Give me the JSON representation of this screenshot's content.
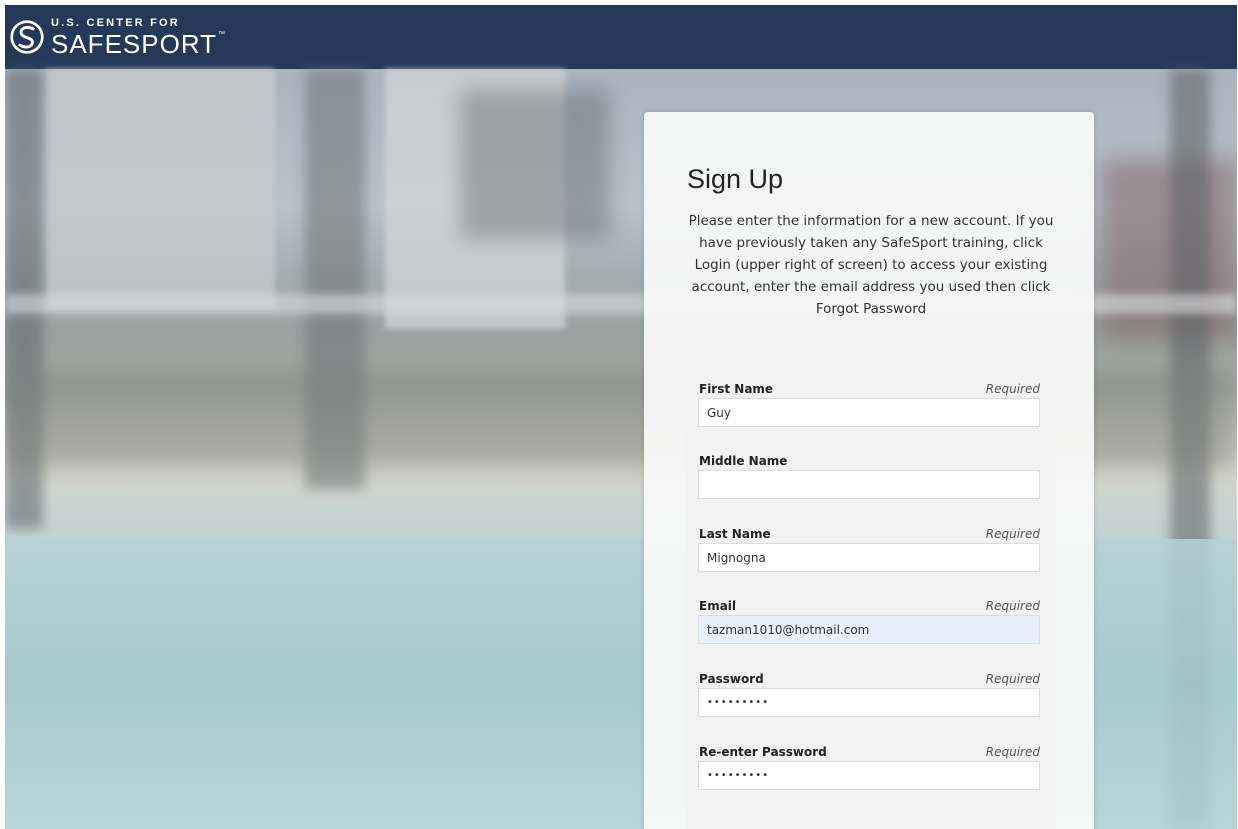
{
  "header": {
    "logo_top": "U.S. CENTER FOR",
    "logo_main": "SAFESPORT",
    "logo_tm": "™",
    "background_color": "#253858"
  },
  "signup": {
    "title": "Sign Up",
    "intro": "Please enter the information for a new account. If you have previously taken any SafeSport training, click Login (upper right of screen) to access your existing account, enter the email address you used then click Forgot Password",
    "fields": [
      {
        "label": "First Name",
        "required_text": "Required",
        "value": "Guy"
      },
      {
        "label": "Middle Name",
        "required_text": "",
        "value": ""
      },
      {
        "label": "Last Name",
        "required_text": "Required",
        "value": "Mignogna"
      },
      {
        "label": "Email",
        "required_text": "Required",
        "value": "tazman1010@hotmail.com"
      },
      {
        "label": "Password",
        "required_text": "Required",
        "value": "•••••••••"
      },
      {
        "label": "Re-enter Password",
        "required_text": "Required",
        "value": "•••••••••"
      }
    ]
  }
}
